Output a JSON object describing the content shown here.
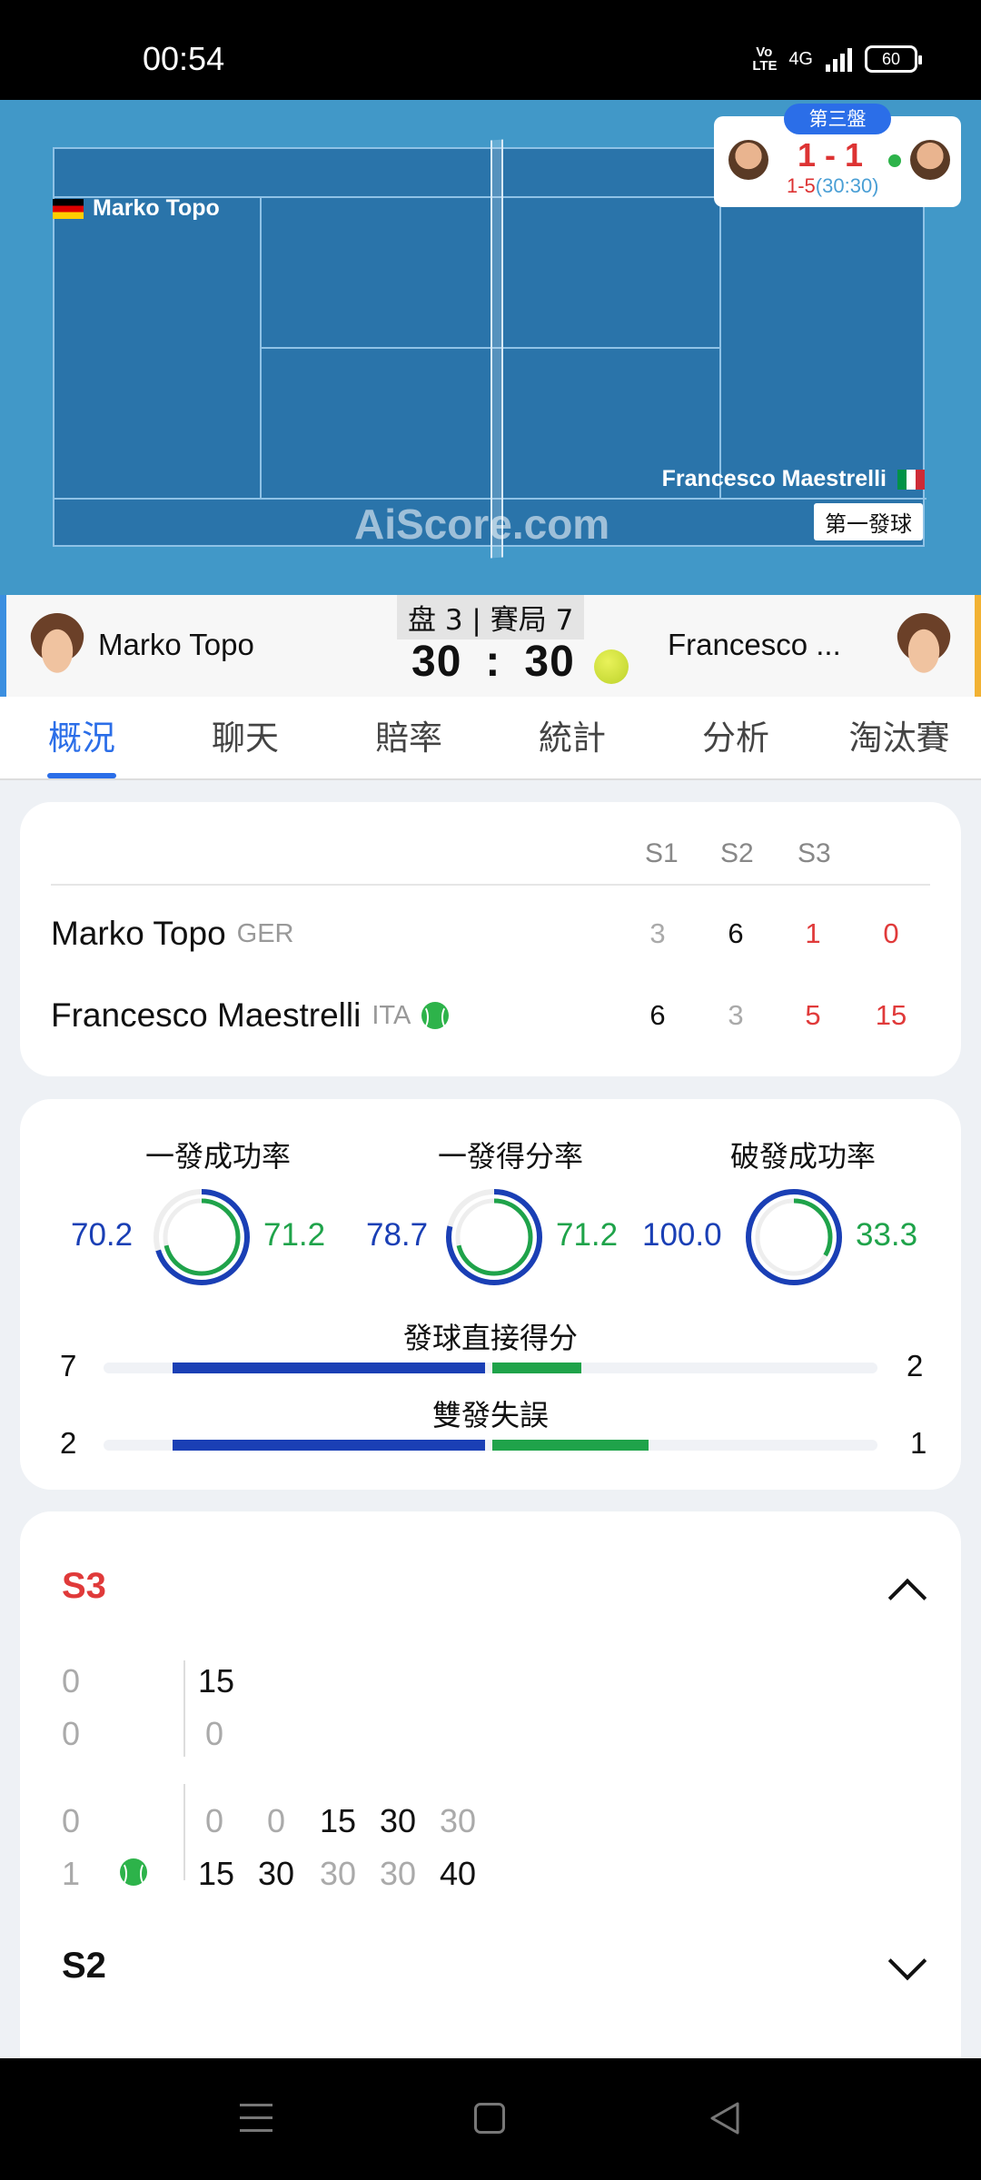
{
  "status_bar": {
    "time": "00:54",
    "volte": "Vo LTE",
    "network": "4G",
    "battery": "60"
  },
  "court": {
    "top_player": "Marko Topo",
    "bottom_player": "Francesco Maestrelli",
    "serve_label": "第一發球",
    "watermark": "AiScore.com",
    "mini_score": {
      "set_label": "第三盤",
      "score": "1 - 1",
      "game": "1-5",
      "point": "(30:30)"
    }
  },
  "header": {
    "left_name": "Marko Topo",
    "right_name": "Francesco ...",
    "set_game": "盘 3 | 賽局 7",
    "left_point": "30",
    "separator": ":",
    "right_point": "30",
    "accent_left": "#3b8fe0",
    "accent_right": "#f2b233"
  },
  "tabs": [
    {
      "label": "概況",
      "active": true
    },
    {
      "label": "聊天"
    },
    {
      "label": "賠率"
    },
    {
      "label": "統計"
    },
    {
      "label": "分析"
    },
    {
      "label": "淘汰賽"
    }
  ],
  "scoreboard": {
    "columns": [
      "S1",
      "S2",
      "S3"
    ],
    "rows": [
      {
        "name": "Marko Topo",
        "country": "GER",
        "sets": [
          "3",
          "6",
          "1"
        ],
        "points": "0",
        "serving": false
      },
      {
        "name": "Francesco Maestrelli",
        "country": "ITA",
        "sets": [
          "6",
          "3",
          "5"
        ],
        "points": "15",
        "serving": true
      }
    ]
  },
  "stats": {
    "rings": [
      {
        "title": "一發成功率",
        "left": "70.2",
        "right": "71.2",
        "left_pct": 70.2,
        "right_pct": 71.2
      },
      {
        "title": "一發得分率",
        "left": "78.7",
        "right": "71.2",
        "left_pct": 78.7,
        "right_pct": 71.2
      },
      {
        "title": "破發成功率",
        "left": "100.0",
        "right": "33.3",
        "left_pct": 100.0,
        "right_pct": 33.3
      }
    ],
    "bars": [
      {
        "title": "發球直接得分",
        "left": "7",
        "right": "2",
        "left_value": 7,
        "right_value": 2
      },
      {
        "title": "雙發失誤",
        "left": "2",
        "right": "1",
        "left_value": 2,
        "right_value": 1
      }
    ],
    "colors": {
      "left": "#1a3fb5",
      "right": "#1fa34a"
    }
  },
  "play_by_play": {
    "current_set": "S3",
    "game1": {
      "top_games": "0",
      "bottom_games": "0",
      "top_points": [
        "15"
      ],
      "bottom_points": [
        "0"
      ]
    },
    "game2": {
      "top_games": "0",
      "bottom_games": "1",
      "top_points": [
        "0",
        "0",
        "15",
        "30",
        "30"
      ],
      "bottom_points": [
        "15",
        "30",
        "30",
        "30",
        "40"
      ]
    },
    "next_set": "S2"
  }
}
